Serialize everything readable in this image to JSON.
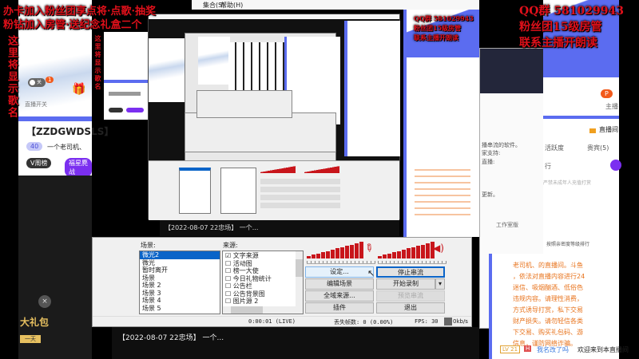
{
  "overlay": {
    "top_left_line1": "办卡加入粉丝团享点将·点歌·抽奖",
    "top_left_line2": "粉钻加入房管·送纪念礼盒二个",
    "song_vertical": "这里将显示歌名",
    "top_right_line1": "QQ群 581029943",
    "top_right_line2": "粉丝团15级房管",
    "top_right_line3": "联系主播开朗读"
  },
  "menu": {
    "item_scenes": "集合(S)",
    "item_help": "帮助(H)"
  },
  "left_page": {
    "toggle_label": "直播开关",
    "toggle_state": "关",
    "badge_count": "1",
    "room_title": "【ZZDGWDSLS】",
    "level": "40",
    "anchor_name": "一个老司机、",
    "weekly_tag": "V周榜",
    "fan_tag": "福星麂战",
    "gift_banner": "大礼包",
    "gift_sub": "一天"
  },
  "video_captions": {
    "caption_upper": "【2022-08-07 22忠场】 一个...",
    "caption_lower": "【2022-08-07 22忠场】 一个..."
  },
  "obs": {
    "scenes_label": "场景:",
    "scenes": [
      "微光2",
      "微光",
      "暂时离开",
      "场景",
      "场景 2",
      "场景 3",
      "场景 4",
      "场景 5"
    ],
    "sources_label": "来源:",
    "sources": [
      {
        "name": "文字来源",
        "checked": true
      },
      {
        "name": "活动图",
        "checked": false
      },
      {
        "name": "榜一大使",
        "checked": false
      },
      {
        "name": "今日礼物统计",
        "checked": false
      },
      {
        "name": "公告栏",
        "checked": false
      },
      {
        "name": "公告背景图",
        "checked": false
      },
      {
        "name": "图片源 2",
        "checked": false
      }
    ],
    "buttons": {
      "settings": "设定...",
      "stop_stream": "停止串流",
      "edit_scene": "编辑场景",
      "start_record": "开始录制",
      "global_sources": "全域来源...",
      "preview_stream": "预览串流",
      "plugins": "插件",
      "exit": "退出"
    },
    "status": {
      "time": "0:00:01 (LIVE)",
      "dropped": "丢失帧数: 0 (0.00%)",
      "fps": "FPS: 30",
      "bitrate": "0kb/s"
    }
  },
  "side_window": {
    "line1": "播串流的软件。",
    "line2": "家支持:",
    "line3": "直播:",
    "line4": "更新。",
    "edition": "工作室版"
  },
  "right_page": {
    "start_button": "P",
    "host_label": "主播",
    "room_link": "直播间",
    "tab_activity": "活跃度",
    "tab_vip": "贵宾(5)",
    "rank_label": "行",
    "minor_notice": "严禁未成年人充值打赏",
    "rank_hint": "按照亲密度等级排行",
    "notice_lines": [
      "老司机、的直播间。斗鱼",
      "，依法对直播内容进行24",
      "迷信、吸烟酗酒、低俗色",
      "违规内容。请理性消费，",
      "方式诱导打赏，私下交易",
      "财产损失。请勿轻信各类",
      "下交易、购买礼包码、游",
      "信息，谨防网络诈骗。"
    ],
    "chat_level": "LV 21",
    "chat_badge": "H",
    "chat_user": "我名改了吗",
    "chat_text": "欢迎来到本直播间"
  },
  "colors": {
    "accent_red": "#c8151b",
    "brand_blue": "#5b6cf0",
    "orange": "#e8731c",
    "purple": "#7b2ff0"
  }
}
